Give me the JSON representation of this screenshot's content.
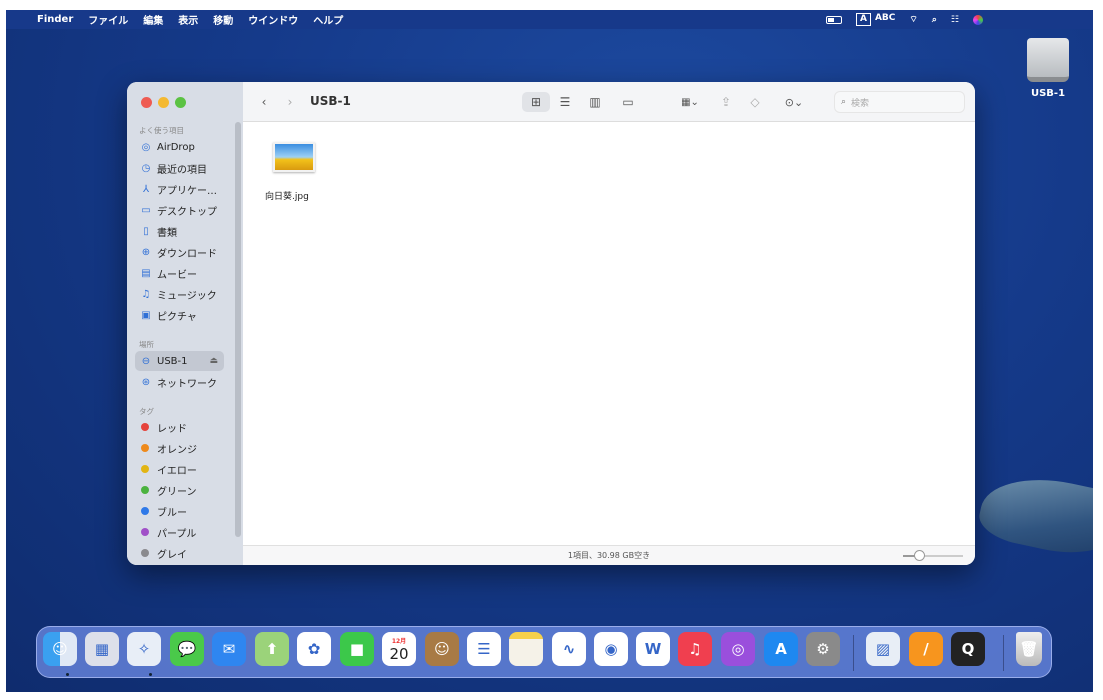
{
  "menubar": {
    "apple_icon": "apple-logo",
    "items": [
      "Finder",
      "ファイル",
      "編集",
      "表示",
      "移動",
      "ウインドウ",
      "ヘルプ"
    ],
    "status": {
      "battery_icon": "battery-icon",
      "input_badge": "A",
      "input_label": "ABC",
      "wifi_icon": "wifi-icon",
      "search_icon": "spotlight-icon",
      "control_icon": "control-center-icon",
      "siri_icon": "siri-icon"
    }
  },
  "desktop": {
    "drive_label": "USB-1"
  },
  "finder": {
    "title": "USB-1",
    "search_placeholder": "検索",
    "sidebar": {
      "favorites_header": "よく使う項目",
      "favorites": [
        {
          "label": "AirDrop",
          "icon": "airdrop-icon",
          "g": "◎"
        },
        {
          "label": "最近の項目",
          "icon": "clock-icon",
          "g": "◷"
        },
        {
          "label": "アプリケー…",
          "icon": "applications-icon",
          "g": "⅄"
        },
        {
          "label": "デスクトップ",
          "icon": "desktop-icon",
          "g": "▭"
        },
        {
          "label": "書類",
          "icon": "document-icon",
          "g": "▯"
        },
        {
          "label": "ダウンロード",
          "icon": "download-icon",
          "g": "⊕"
        },
        {
          "label": "ムービー",
          "icon": "film-icon",
          "g": "▤"
        },
        {
          "label": "ミュージック",
          "icon": "music-icon",
          "g": "♫"
        },
        {
          "label": "ピクチャ",
          "icon": "photo-icon",
          "g": "▣"
        }
      ],
      "locations_header": "場所",
      "locations": [
        {
          "label": "USB-1",
          "icon": "drive-icon",
          "g": "⊖",
          "selected": true,
          "eject": "⏏"
        },
        {
          "label": "ネットワーク",
          "icon": "network-icon",
          "g": "⊛"
        }
      ],
      "tags_header": "タグ",
      "tags": [
        {
          "label": "レッド",
          "color": "#e5433c"
        },
        {
          "label": "オレンジ",
          "color": "#ee8a1c"
        },
        {
          "label": "イエロー",
          "color": "#e2b514"
        },
        {
          "label": "グリーン",
          "color": "#4bb33f"
        },
        {
          "label": "ブルー",
          "color": "#2f79e8"
        },
        {
          "label": "パープル",
          "color": "#a050c8"
        },
        {
          "label": "グレイ",
          "color": "#8a8a8e"
        }
      ]
    },
    "files": [
      {
        "name": "向日葵.jpg"
      }
    ],
    "status_text": "1項目、30.98 GB空き",
    "icon_size_slider": 0.2
  },
  "dock": {
    "apps": [
      "Finder",
      "Launchpad",
      "Safari",
      "メッセージ",
      "メール",
      "マップ",
      "写真",
      "FaceTime",
      "カレンダー",
      "連絡先",
      "リマインダー",
      "メモ",
      "フリーボード",
      "Google Chrome",
      "Microsoft Word",
      "ミュージック",
      "Podcast",
      "App Store",
      "システム設定",
      "プレビュー",
      "Pages",
      "QuickTime Player",
      "ゴミ箱"
    ],
    "calendar_month": "12月",
    "calendar_day": "20"
  }
}
